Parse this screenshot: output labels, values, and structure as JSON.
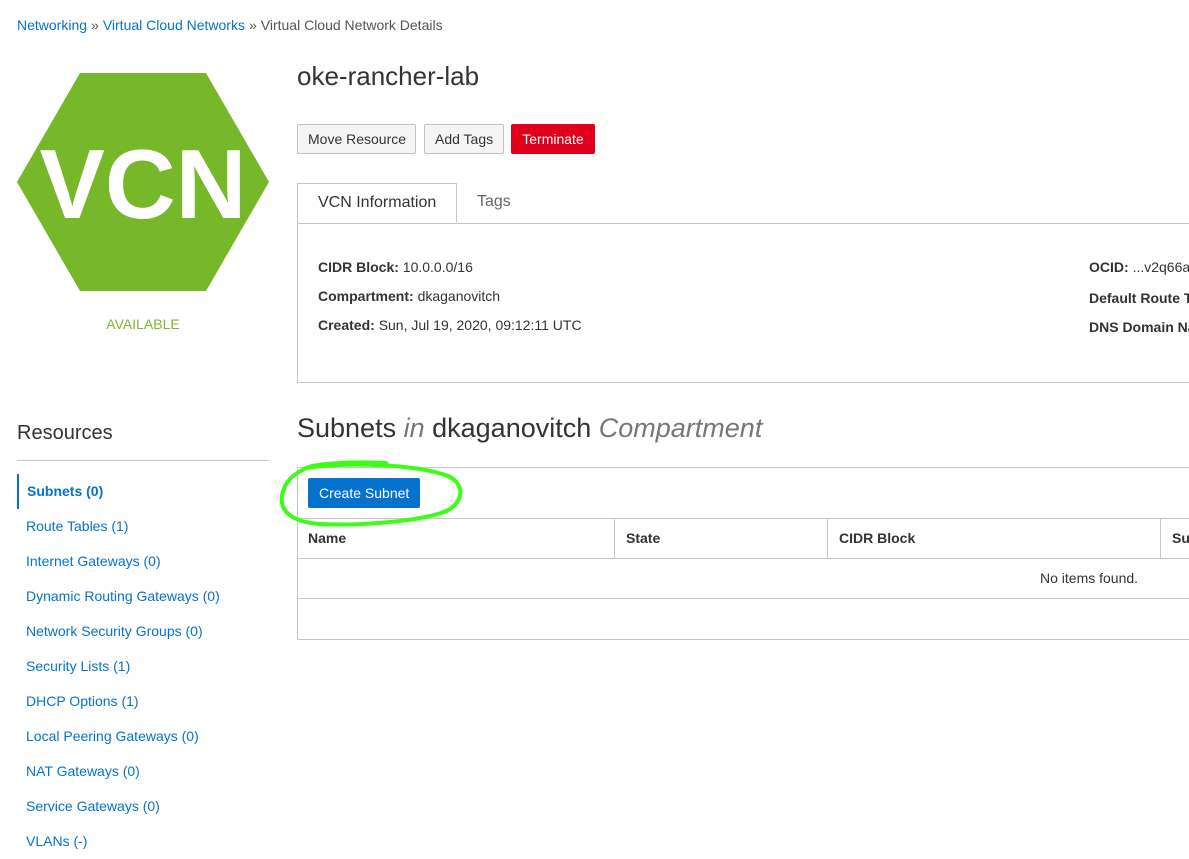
{
  "breadcrumb": {
    "items": [
      "Networking",
      "Virtual Cloud Networks"
    ],
    "separator": "»",
    "current": "Virtual Cloud Network Details"
  },
  "vcn_badge": {
    "text": "VCN",
    "color": "#76b82a",
    "status": "AVAILABLE"
  },
  "page_title": "oke-rancher-lab",
  "actions": {
    "move_resource": "Move Resource",
    "add_tags": "Add Tags",
    "terminate": "Terminate"
  },
  "tabs": [
    {
      "label": "VCN Information",
      "active": true
    },
    {
      "label": "Tags",
      "active": false
    }
  ],
  "info": {
    "cidr_label": "CIDR Block:",
    "cidr_value": "10.0.0.0/16",
    "compartment_label": "Compartment:",
    "compartment_value": "dkaganovitch",
    "created_label": "Created:",
    "created_value": "Sun, Jul 19, 2020, 09:12:11 UTC",
    "ocid_label": "OCID:",
    "ocid_value": "...v2q66a",
    "default_route_label": "Default Route T",
    "dns_label": "DNS Domain Na"
  },
  "resources": {
    "title": "Resources",
    "items": [
      {
        "label": "Subnets (0)",
        "active": true
      },
      {
        "label": "Route Tables (1)"
      },
      {
        "label": "Internet Gateways (0)"
      },
      {
        "label": "Dynamic Routing Gateways (0)"
      },
      {
        "label": "Network Security Groups (0)"
      },
      {
        "label": "Security Lists (1)"
      },
      {
        "label": "DHCP Options (1)"
      },
      {
        "label": "Local Peering Gateways (0)"
      },
      {
        "label": "NAT Gateways (0)"
      },
      {
        "label": "Service Gateways (0)"
      },
      {
        "label": "VLANs (-)"
      }
    ]
  },
  "subnets": {
    "title_main": "Subnets",
    "title_in": "in",
    "title_compartment": "dkaganovitch",
    "title_suffix": "Compartment",
    "create_button": "Create Subnet",
    "columns": [
      "Name",
      "State",
      "CIDR Block",
      "Su"
    ],
    "empty_text": "No items found."
  },
  "colors": {
    "link": "#0572ce",
    "danger": "#e0001b",
    "primary": "#0572ce",
    "highlight": "#39ff14",
    "vcn_green": "#76b82a"
  }
}
